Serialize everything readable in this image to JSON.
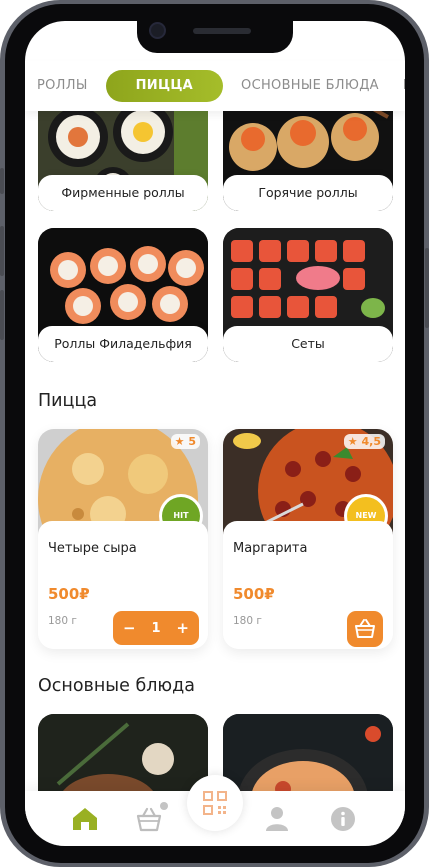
{
  "tabs": [
    {
      "label": "РОЛЛЫ",
      "active": false
    },
    {
      "label": "ПИЦЦА",
      "active": true
    },
    {
      "label": "ОСНОВНЫЕ БЛЮДА",
      "active": false
    },
    {
      "label": "Н",
      "active": false
    }
  ],
  "categories": [
    {
      "label": "Фирменные роллы",
      "image_icon": "sushi-rolls-icon"
    },
    {
      "label": "Горячие роллы",
      "image_icon": "hot-rolls-icon"
    },
    {
      "label": "Роллы Филадельфия",
      "image_icon": "philadelphia-rolls-icon"
    },
    {
      "label": "Сеты",
      "image_icon": "sushi-set-icon"
    }
  ],
  "sections": {
    "pizza_title": "Пицца",
    "main_title": "Основные блюда"
  },
  "products": [
    {
      "name": "Четыре сыра",
      "price": "500₽",
      "weight": "180 г",
      "rating": "5",
      "badge": "HIT",
      "quantity": "1",
      "minus": "−",
      "plus": "+"
    },
    {
      "name": "Маргарита",
      "price": "500₽",
      "weight": "180 г",
      "rating": "4,5",
      "badge": "NEW"
    }
  ],
  "nav": {
    "items": [
      "home-icon",
      "cart-icon",
      "qr-icon",
      "profile-icon",
      "info-icon"
    ]
  },
  "colors": {
    "accent_green": "#99b023",
    "accent_orange": "#f08a2d"
  }
}
